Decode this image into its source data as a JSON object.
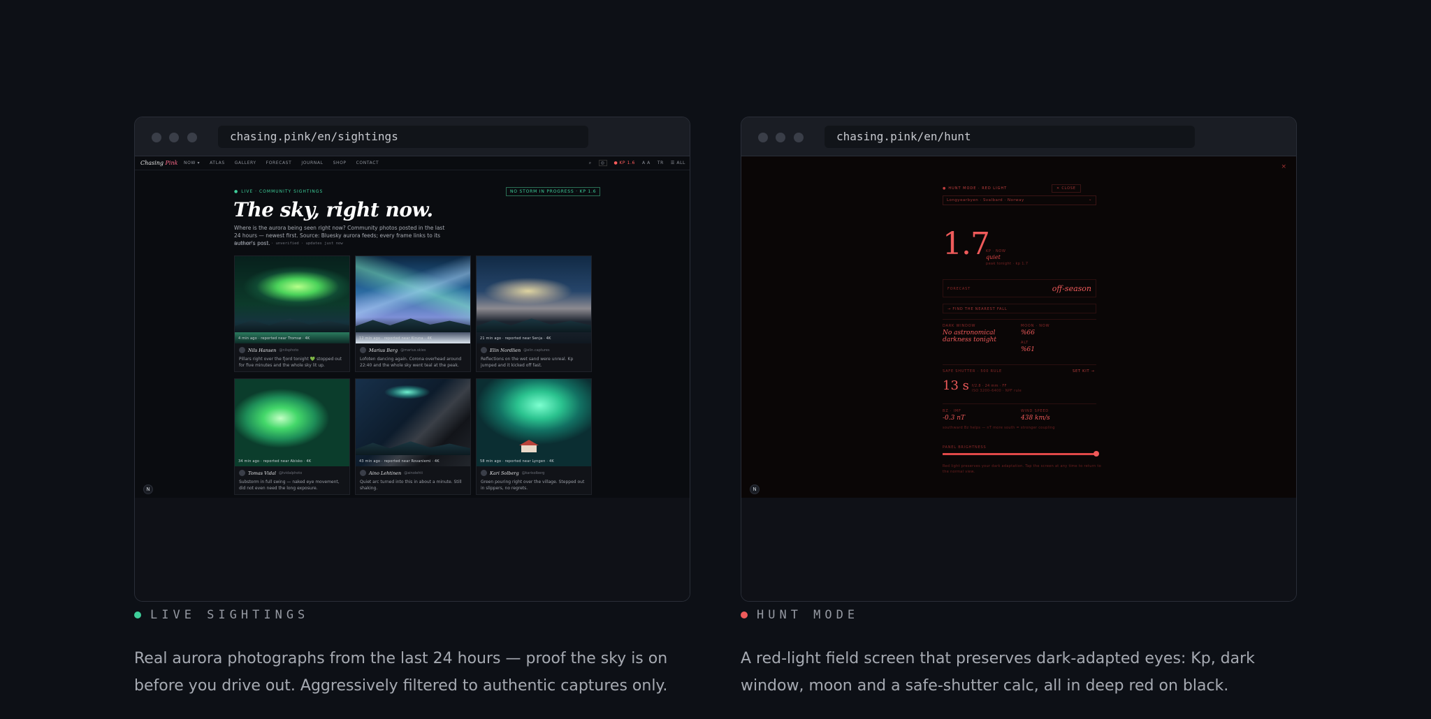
{
  "left": {
    "url": "chasing.pink/en/sightings",
    "nav": {
      "brand_a": "Chasing",
      "brand_b": "Pink",
      "links": [
        "NOW ▾",
        "ATLAS",
        "GALLERY",
        "FORECAST",
        "JOURNAL",
        "SHOP",
        "CONTACT"
      ],
      "search_glyph": "⌕",
      "account_glyph": "◎",
      "kp_pill": "KP 1.6",
      "text_size": "A A",
      "lang": "TR",
      "all": "☰ ALL"
    },
    "hero": {
      "live_tag": "LIVE · COMMUNITY SIGHTINGS",
      "badge": "NO STORM IN PROGRESS · KP 1.6",
      "title": "The sky, right now.",
      "desc": "Where is the aurora being seen right now? Community photos posted in the last 24 hours — newest first. Source: Bluesky aurora feeds; every frame links to its author's post.",
      "meta": "Community posts · unverified · updates just now"
    },
    "cards": [
      {
        "name": "Nils Hansen",
        "handle": "@nilsphoto",
        "caption": "4 min ago · reported near Tromsø · 4K",
        "text": "Pillars right over the fjord tonight 💚 stopped out for five minutes and the whole sky lit up."
      },
      {
        "name": "Marius Berg",
        "handle": "@marius.skies",
        "caption": "12 min ago · reported near Kiruna · 4K",
        "text": "Lofoten dancing again. Corona overhead around 22:40 and the whole sky went teal at the peak."
      },
      {
        "name": "Elin Nordlien",
        "handle": "@elin.captures",
        "caption": "21 min ago · reported near Senja · 4K",
        "text": "Reflections on the wet sand were unreal. Kp jumped and it kicked off fast."
      },
      {
        "name": "Tomas Vidal",
        "handle": "@tvidalphoto",
        "caption": "34 min ago · reported near Abisko · 4K",
        "text": "Substorm in full swing — naked eye movement, did not even need the long exposure."
      },
      {
        "name": "Aino Lehtinen",
        "handle": "@ainolehti",
        "caption": "43 min ago · reported near Rovaniemi · 4K",
        "text": "Quiet arc turned into this in about a minute. Still shaking."
      },
      {
        "name": "Kari Solberg",
        "handle": "@karisolberg",
        "caption": "58 min ago · reported near Lyngen · 4K",
        "text": "Green pouring right over the village. Stepped out in slippers, no regrets."
      }
    ],
    "corner_badge": "N",
    "section_label": "LIVE SIGHTINGS",
    "dot_color": "#3ecf9a",
    "description": "Real aurora photographs from the last 24 hours — proof the sky is on before you drive out. Aggressively filtered to authentic captures only."
  },
  "right": {
    "url": "chasing.pink/en/hunt",
    "close_glyph": "×",
    "tag": "HUNT MODE · RED LIGHT",
    "exit": "✕ CLOSE",
    "location": "Longyearbyen · Svalbard · Norway",
    "location_chevron": "⌄",
    "kp": "1.7",
    "kp_label": "KP · NOW",
    "kp_state": "quiet",
    "kp_sub": "peak tonight · kp 1.7",
    "forecast_label": "FORECAST",
    "forecast_value": "off-season",
    "button": "→ FIND THE NEAREST FALL",
    "dark_label": "DARK WINDOW",
    "dark_value": "No astronomical darkness tonight",
    "moon_label": "MOON · NOW",
    "moon_value": "%66",
    "alt_label": "ALT",
    "alt_value": "%61",
    "shutter_label": "SAFE SHUTTER · 500 RULE",
    "shutter_link": "SET KIT →",
    "shutter_value": "13 s",
    "shutter_meta1": "f/2.8 · 24 mm · FF",
    "shutter_meta2": "ISO 3200–6400 · NPF rule",
    "bz_label": "BZ · IMF",
    "bz_value": "-0.3 nT",
    "wind_label": "WIND SPEED",
    "wind_value": "438 km/s",
    "bz_note": "southward Bz helps — nT more south = stronger coupling",
    "brightness_label": "PANEL BRIGHTNESS",
    "brightness": 1.0,
    "footer": "Red light preserves your dark adaptation. Tap the screen at any time to return to the normal view.",
    "corner_badge": "N",
    "section_label": "HUNT MODE",
    "dot_color": "#ef5a5a",
    "description": "A red-light field screen that preserves dark-adapted eyes: Kp, dark window, moon and a safe-shutter calc, all in deep red on black."
  }
}
